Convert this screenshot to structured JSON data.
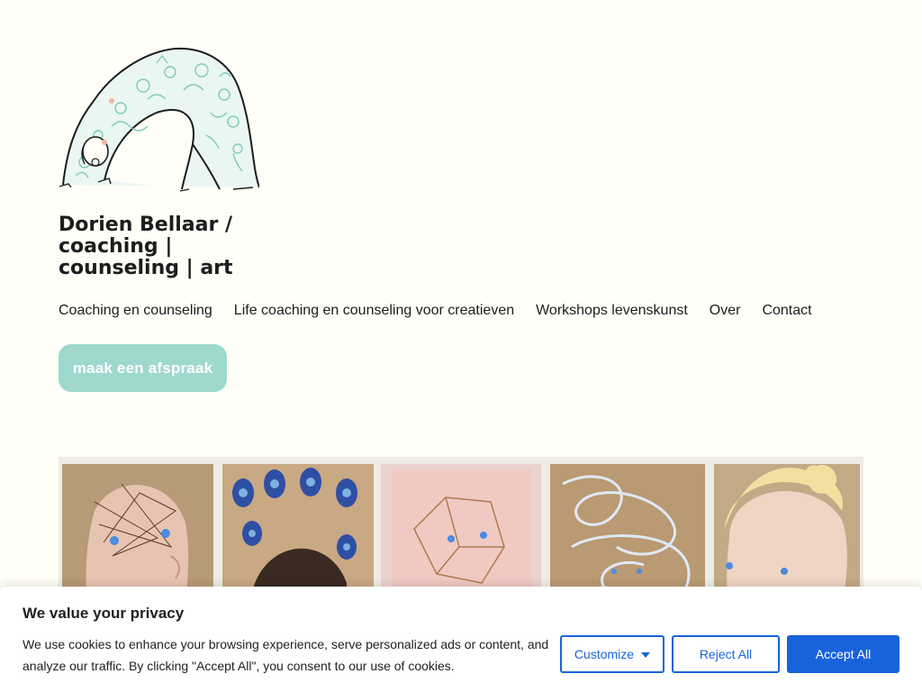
{
  "site": {
    "title": "Dorien Bellaar / coaching | counseling | art"
  },
  "nav": {
    "items": [
      {
        "label": "Coaching en counseling"
      },
      {
        "label": "Life coaching en counseling voor creatieven"
      },
      {
        "label": "Workshops levenskunst"
      },
      {
        "label": "Over"
      },
      {
        "label": "Contact"
      }
    ]
  },
  "cta": {
    "label": "maak een afspraak",
    "color": "#9ed8cf"
  },
  "cookie_banner": {
    "title": "We value your privacy",
    "text": "We use cookies to enhance your browsing experience, serve personalized ads or content, and analyze our traffic. By clicking \"Accept All\", you consent to our use of cookies.",
    "customize_label": "Customize",
    "reject_label": "Reject All",
    "accept_label": "Accept All",
    "accent_color": "#1863dc"
  },
  "icons": {
    "logo": "person-in-bridge-pose-illustration",
    "customize_caret": "caret-down-icon"
  }
}
